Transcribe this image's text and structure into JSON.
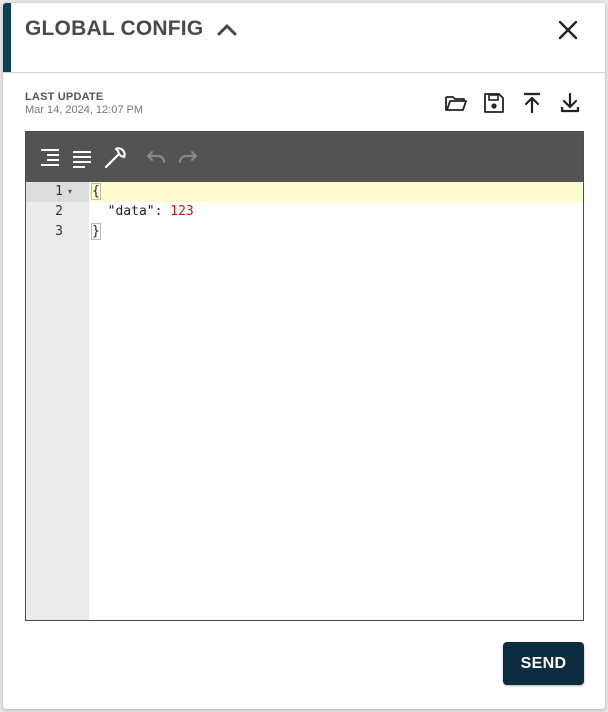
{
  "header": {
    "title": "GLOBAL CONFIG",
    "accent_color": "#0c3f59",
    "collapse_icon": "chevron-up-icon",
    "close_icon": "close-icon"
  },
  "meta": {
    "label": "LAST UPDATE",
    "date": "Mar 14, 2024, 12:07 PM"
  },
  "actions": [
    {
      "name": "open-folder-icon"
    },
    {
      "name": "save-icon"
    },
    {
      "name": "upload-icon"
    },
    {
      "name": "download-icon"
    }
  ],
  "editor": {
    "toolbar_color": "#535353",
    "tools": [
      "format-icon",
      "compact-icon",
      "repair-icon",
      "undo-icon",
      "redo-icon"
    ],
    "lines": [
      {
        "number": "1",
        "foldable": true,
        "indent": "",
        "open": "{",
        "key": "",
        "colon": "",
        "value": ""
      },
      {
        "number": "2",
        "foldable": false,
        "indent": "  ",
        "open": "",
        "key": "\"data\"",
        "colon": ": ",
        "value": "123"
      },
      {
        "number": "3",
        "foldable": false,
        "indent": "",
        "open": "}",
        "key": "",
        "colon": "",
        "value": ""
      }
    ],
    "fold_glyph": "▾"
  },
  "footer": {
    "send_label": "SEND",
    "send_color": "#0c2d40"
  }
}
